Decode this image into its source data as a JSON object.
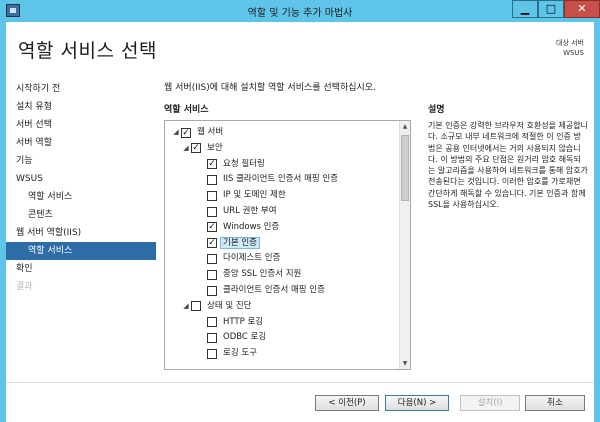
{
  "window": {
    "title": "역할 및 기능 추가 마법사",
    "minimize": "▁",
    "maximize": "□",
    "close": "✕"
  },
  "page_title": "역할 서비스 선택",
  "destination": {
    "label": "대상 서버",
    "server": "WSUS"
  },
  "nav": [
    {
      "label": "시작하기 전",
      "level": 0,
      "state": "normal"
    },
    {
      "label": "설치 유형",
      "level": 0,
      "state": "normal"
    },
    {
      "label": "서버 선택",
      "level": 0,
      "state": "normal"
    },
    {
      "label": "서버 역할",
      "level": 0,
      "state": "normal"
    },
    {
      "label": "기능",
      "level": 0,
      "state": "normal"
    },
    {
      "label": "WSUS",
      "level": 0,
      "state": "normal"
    },
    {
      "label": "역할 서비스",
      "level": 1,
      "state": "normal"
    },
    {
      "label": "콘텐츠",
      "level": 1,
      "state": "normal"
    },
    {
      "label": "웹 서버 역할(IIS)",
      "level": 0,
      "state": "normal"
    },
    {
      "label": "역할 서비스",
      "level": 1,
      "state": "active"
    },
    {
      "label": "확인",
      "level": 0,
      "state": "normal"
    },
    {
      "label": "결과",
      "level": 0,
      "state": "disabled"
    }
  ],
  "instruction": "웹 서버(IIS)에 대해 설치할 역할 서비스를 선택하십시오.",
  "role_services_label": "역할 서비스",
  "description_label": "설명",
  "tree": [
    {
      "label": "웹 서버",
      "depth": 0,
      "expander": "◢",
      "checked": true,
      "selected": false
    },
    {
      "label": "보안",
      "depth": 1,
      "expander": "◢",
      "checked": true,
      "selected": false
    },
    {
      "label": "요청 필터링",
      "depth": 2,
      "expander": "",
      "checked": true,
      "selected": false
    },
    {
      "label": "IIS 클라이언트 인증서 매핑 인증",
      "depth": 2,
      "expander": "",
      "checked": false,
      "selected": false
    },
    {
      "label": "IP 및 도메인 제한",
      "depth": 2,
      "expander": "",
      "checked": false,
      "selected": false
    },
    {
      "label": "URL 권한 부여",
      "depth": 2,
      "expander": "",
      "checked": false,
      "selected": false
    },
    {
      "label": "Windows 인증",
      "depth": 2,
      "expander": "",
      "checked": true,
      "selected": false
    },
    {
      "label": "기본 인증",
      "depth": 2,
      "expander": "",
      "checked": true,
      "selected": true
    },
    {
      "label": "다이제스트 인증",
      "depth": 2,
      "expander": "",
      "checked": false,
      "selected": false
    },
    {
      "label": "중앙 SSL 인증서 지원",
      "depth": 2,
      "expander": "",
      "checked": false,
      "selected": false
    },
    {
      "label": "클라이언트 인증서 매핑 인증",
      "depth": 2,
      "expander": "",
      "checked": false,
      "selected": false
    },
    {
      "label": "상태 및 진단",
      "depth": 1,
      "expander": "◢",
      "checked": false,
      "selected": false
    },
    {
      "label": "HTTP 로깅",
      "depth": 2,
      "expander": "",
      "checked": false,
      "selected": false
    },
    {
      "label": "ODBC 로깅",
      "depth": 2,
      "expander": "",
      "checked": false,
      "selected": false
    },
    {
      "label": "로깅 도구",
      "depth": 2,
      "expander": "",
      "checked": false,
      "selected": false
    }
  ],
  "description": "기본 인증은 강력한 브라우저 호환성을 제공합니다. 소규모 내부 네트워크에 적절한 이 인증 방법은 공용 인터넷에서는 거의 사용되지 않습니다. 이 방법의 주요 단점은 원거리 암호 해독되는 알고리즘을 사용하여 네트워크를 통해 암호가 전송된다는 것입니다. 이러한 암호를 가로채면 간단하게 해독할 수 있습니다. 기본 인증과 함께 SSL을 사용하십시오.",
  "buttons": {
    "prev": "< 이전(P)",
    "next": "다음(N) >",
    "install": "설치(I)",
    "cancel": "취소"
  }
}
